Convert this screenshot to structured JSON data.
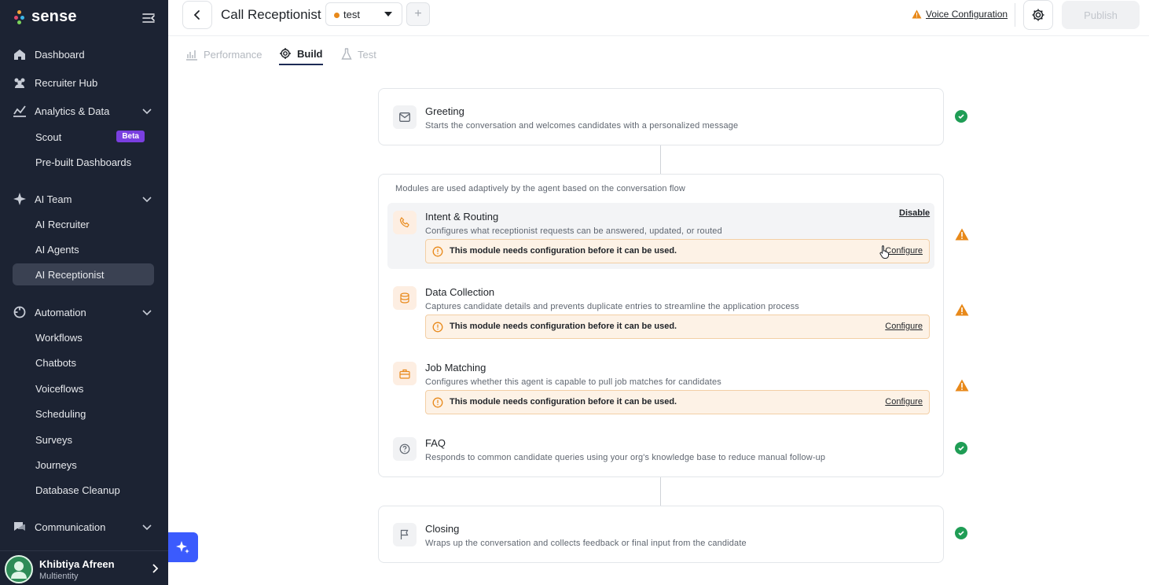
{
  "app": {
    "logo_text": "sense"
  },
  "sidebar": {
    "nav": [
      {
        "label": "Dashboard",
        "icon": "home-icon"
      },
      {
        "label": "Recruiter Hub",
        "icon": "people-icon"
      },
      {
        "label": "Analytics & Data",
        "icon": "chart-icon",
        "expanded": true
      },
      {
        "label": "AI Team",
        "icon": "sparkle-icon",
        "expanded": true
      },
      {
        "label": "Automation",
        "icon": "automation-icon",
        "expanded": true
      },
      {
        "label": "Communication",
        "icon": "chat-icon",
        "expanded": false
      }
    ],
    "analytics_sub": [
      {
        "label": "Scout",
        "badge": "Beta"
      },
      {
        "label": "Pre-built Dashboards"
      }
    ],
    "ai_team_sub": [
      {
        "label": "AI Recruiter"
      },
      {
        "label": "AI Agents"
      },
      {
        "label": "AI Receptionist",
        "active": true
      }
    ],
    "automation_sub": [
      {
        "label": "Workflows"
      },
      {
        "label": "Chatbots"
      },
      {
        "label": "Voiceflows"
      },
      {
        "label": "Scheduling"
      },
      {
        "label": "Surveys"
      },
      {
        "label": "Journeys"
      },
      {
        "label": "Database Cleanup"
      }
    ],
    "user": {
      "name": "Khibtiya Afreen",
      "org": "Multientity"
    }
  },
  "header": {
    "title": "Call Receptionist",
    "env_value": "test",
    "plus_label": "+",
    "voice_config_label": "Voice Configuration",
    "publish_label": "Publish"
  },
  "tabs": [
    {
      "label": "Performance",
      "icon": "bar-chart-icon",
      "active": false
    },
    {
      "label": "Build",
      "icon": "gear-icon",
      "active": true
    },
    {
      "label": "Test",
      "icon": "flask-icon",
      "active": false
    }
  ],
  "flow": {
    "greeting": {
      "title": "Greeting",
      "desc": "Starts the conversation and welcomes candidates with a personalized message",
      "status": "ok"
    },
    "modules_hint": "Modules are used adaptively by the agent based on the conversation flow",
    "disable_label": "Disable",
    "modules": [
      {
        "title": "Intent & Routing",
        "desc": "Configures what receptionist requests can be answered, updated, or routed",
        "warning": "This module needs configuration before it can be used.",
        "link": "Configure",
        "status": "warn"
      },
      {
        "title": "Data Collection",
        "desc": "Captures candidate details and prevents duplicate entries to streamline the application process",
        "warning": "This module needs configuration before it can be used.",
        "link": "Configure",
        "status": "warn"
      },
      {
        "title": "Job Matching",
        "desc": "Configures whether this agent is capable to pull job matches for candidates",
        "warning": "This module needs configuration before it can be used.",
        "link": "Configure",
        "status": "warn"
      },
      {
        "title": "FAQ",
        "desc": "Responds to common candidate queries using your org's knowledge base to reduce manual follow-up",
        "status": "ok"
      }
    ],
    "closing": {
      "title": "Closing",
      "desc": "Wraps up the conversation and collects feedback or final input from the candidate",
      "status": "ok"
    }
  },
  "colors": {
    "sidebar_bg": "#1c2333",
    "active_item_bg": "#3a4152",
    "beta_badge": "#7a3fe0",
    "warning_bg": "#fdf2e6",
    "warning_icon": "#e8891a",
    "success": "#1f9d55",
    "fab": "#3b5bfd"
  }
}
